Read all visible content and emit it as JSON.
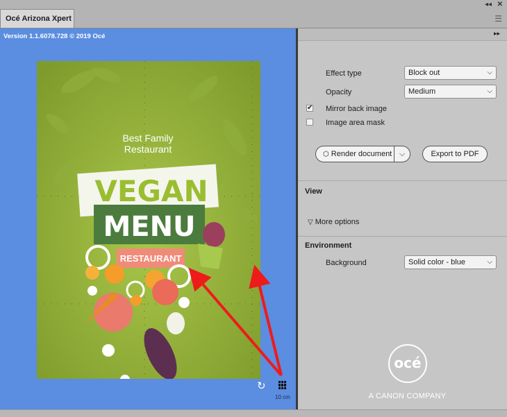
{
  "window": {
    "tab_title": "Océ Arizona Xpert",
    "collapse_icon": "double-chevron-left-icon",
    "close_icon": "close-icon",
    "menu_icon": "hamburger-menu-icon"
  },
  "preview": {
    "version_text": "Version 1.1.6078.728 © 2019 Océ",
    "background_color": "#5b8de0",
    "poster": {
      "top_line1": "Best Family",
      "top_line2": "Restaurant",
      "word1": "VEGAN",
      "word2": "MENU",
      "badge": "RESTAURANT"
    },
    "grid_scale": "10 cm",
    "reset_icon": "rotate-icon",
    "grid_icon": "grid-icon"
  },
  "panel": {
    "expand_icon": "double-chevron-right-icon",
    "effect_type": {
      "label": "Effect type",
      "value": "Block out"
    },
    "opacity": {
      "label": "Opacity",
      "value": "Medium"
    },
    "mirror_back": {
      "label": "Mirror back image",
      "checked": true
    },
    "image_mask": {
      "label": "Image area mask",
      "checked": false
    },
    "render_button": "Render document",
    "export_button": "Export to PDF",
    "view_section": "View",
    "more_options": "More options",
    "environment_section": "Environment",
    "background": {
      "label": "Background",
      "value": "Solid color - blue"
    },
    "brand_logo": "océ",
    "brand_tagline": "A CANON COMPANY"
  }
}
